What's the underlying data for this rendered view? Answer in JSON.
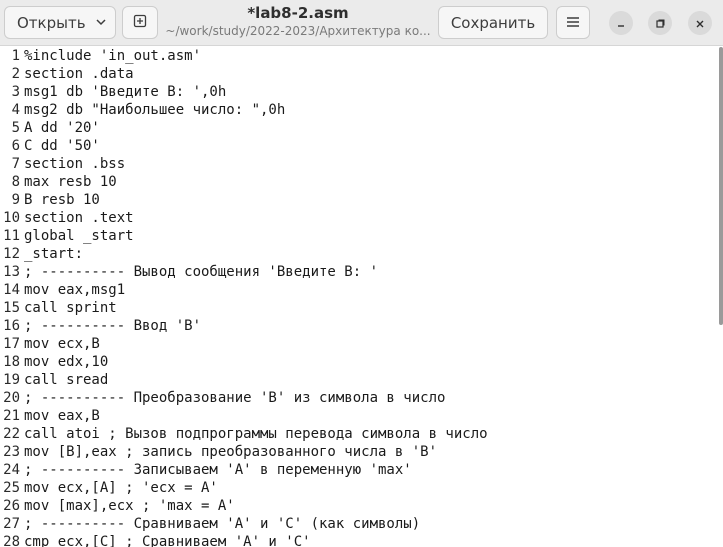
{
  "header": {
    "open_label": "Открыть",
    "title": "*lab8-2.asm",
    "subtitle": "~/work/study/2022-2023/Архитектура ко...",
    "save_label": "Сохранить"
  },
  "editor": {
    "lines": [
      {
        "n": "1",
        "text": "%include 'in_out.asm'"
      },
      {
        "n": "2",
        "text": "section .data"
      },
      {
        "n": "3",
        "text": "msg1 db 'Введите B: ',0h"
      },
      {
        "n": "4",
        "text": "msg2 db \"Наибольшее число: \",0h"
      },
      {
        "n": "5",
        "text": "A dd '20'"
      },
      {
        "n": "6",
        "text": "C dd '50'"
      },
      {
        "n": "7",
        "text": "section .bss"
      },
      {
        "n": "8",
        "text": "max resb 10"
      },
      {
        "n": "9",
        "text": "B resb 10"
      },
      {
        "n": "10",
        "text": "section .text"
      },
      {
        "n": "11",
        "text": "global _start"
      },
      {
        "n": "12",
        "text": "_start:"
      },
      {
        "n": "13",
        "text": "; ---------- Вывод сообщения 'Введите B: '"
      },
      {
        "n": "14",
        "text": "mov eax,msg1"
      },
      {
        "n": "15",
        "text": "call sprint"
      },
      {
        "n": "16",
        "text": "; ---------- Ввод 'B'"
      },
      {
        "n": "17",
        "text": "mov ecx,B"
      },
      {
        "n": "18",
        "text": "mov edx,10"
      },
      {
        "n": "19",
        "text": "call sread"
      },
      {
        "n": "20",
        "text": "; ---------- Преобразование 'B' из символа в число"
      },
      {
        "n": "21",
        "text": "mov eax,B"
      },
      {
        "n": "22",
        "text": "call atoi ; Вызов подпрограммы перевода символа в число"
      },
      {
        "n": "23",
        "text": "mov [B],eax ; запись преобразованного числа в 'B'"
      },
      {
        "n": "24",
        "text": "; ---------- Записываем 'A' в переменную 'max'"
      },
      {
        "n": "25",
        "text": "mov ecx,[A] ; 'ecx = A'"
      },
      {
        "n": "26",
        "text": "mov [max],ecx ; 'max = A'"
      },
      {
        "n": "27",
        "text": "; ---------- Сравниваем 'A' и 'C' (как символы)"
      },
      {
        "n": "28",
        "text": "cmp ecx,[C] ; Сравниваем 'A' и 'C'"
      }
    ]
  }
}
